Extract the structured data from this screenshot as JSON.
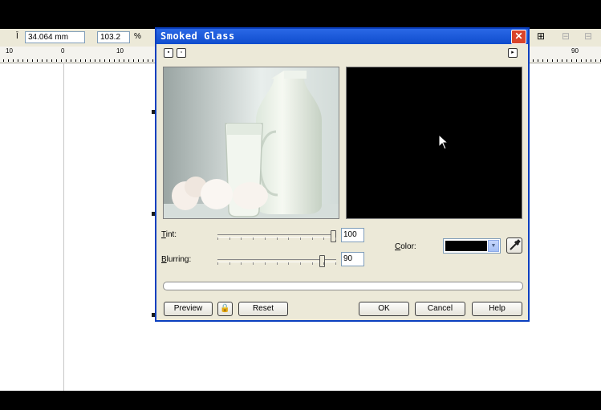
{
  "propbar": {
    "height_value": "34.064 mm",
    "scale_value": "103.2",
    "scale_unit": "%"
  },
  "ruler": {
    "labels": [
      "10",
      "0",
      "10",
      "90"
    ]
  },
  "dialog": {
    "title": "Smoked Glass",
    "tint": {
      "label_key": "T",
      "label_rest": "int:",
      "value": "100",
      "level": 1.0
    },
    "blurring": {
      "label_key": "B",
      "label_rest": "lurring:",
      "value": "90",
      "level": 0.9
    },
    "color": {
      "label_key": "C",
      "label_rest": "olor:",
      "swatch": "#000000"
    },
    "buttons": {
      "preview": "Preview",
      "reset": "Reset",
      "ok": "OK",
      "cancel": "Cancel",
      "help": "Help"
    }
  },
  "colors": {
    "titlebar": "#0f4ccd",
    "dialog_bg": "#ece9d8",
    "preview_after": "#000000"
  }
}
